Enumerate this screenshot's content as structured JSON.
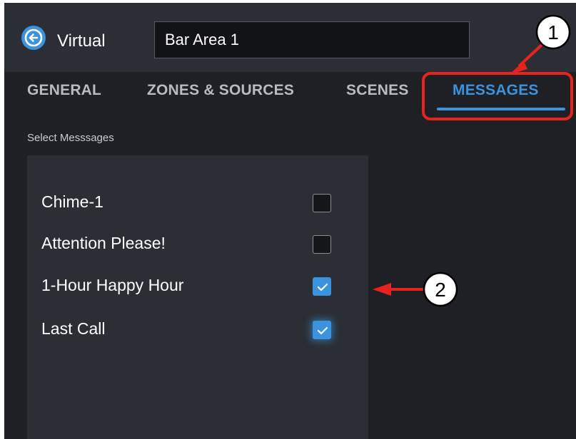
{
  "header": {
    "virtual_label": "Virtual",
    "name_value": "Bar Area 1"
  },
  "tabs": [
    {
      "label": "GENERAL",
      "active": false
    },
    {
      "label": "ZONES & SOURCES",
      "active": false
    },
    {
      "label": "SCENES",
      "active": false
    },
    {
      "label": "MESSAGES",
      "active": true
    }
  ],
  "section_label": "Select Messsages",
  "messages": [
    {
      "label": "Chime-1",
      "checked": false
    },
    {
      "label": "Attention Please!",
      "checked": false
    },
    {
      "label": "1-Hour Happy Hour",
      "checked": true
    },
    {
      "label": "Last Call",
      "checked": true
    }
  ],
  "callouts": [
    {
      "number": "1"
    },
    {
      "number": "2"
    }
  ],
  "colors": {
    "accent": "#3a93dc",
    "callout_red": "#e8231d",
    "background": "#1e2025",
    "panel": "#2b2e34"
  },
  "icons": {
    "back": "arrow-left-circle-icon",
    "check": "checkmark-icon"
  }
}
